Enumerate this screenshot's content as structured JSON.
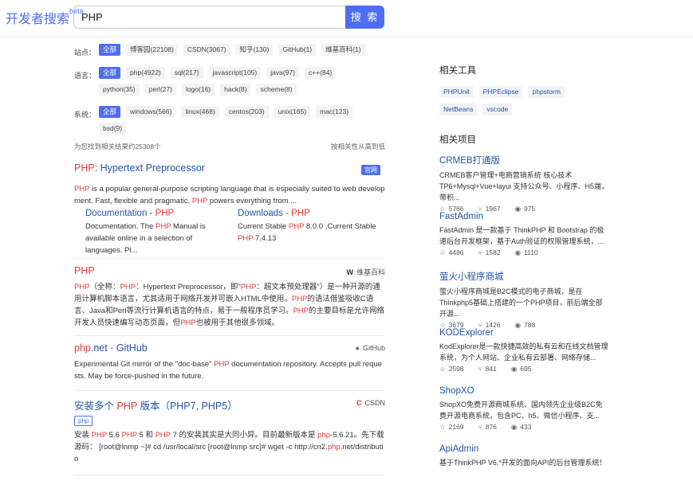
{
  "header": {
    "logo_text": "开发者搜索",
    "logo_beta": "beta",
    "query": "PHP",
    "search_button": "搜 索"
  },
  "filters": {
    "site": {
      "label": "站点：",
      "chips": [
        "全部",
        "博客园(22108)",
        "CSDN(3067)",
        "知乎(130)",
        "GitHub(1)",
        "维基百科(1)"
      ]
    },
    "language": {
      "label": "语言：",
      "chips": [
        "全部",
        "php(4922)",
        "sql(217)",
        "javascript(105)",
        "java(97)",
        "c++(84)",
        "python(35)",
        "perl(27)",
        "logo(16)",
        "hack(8)",
        "scheme(8)"
      ]
    },
    "system": {
      "label": "系统：",
      "chips": [
        "全部",
        "windows(566)",
        "linux(468)",
        "centos(203)",
        "unix(165)",
        "mac(123)",
        "bsd(9)"
      ]
    }
  },
  "meta": {
    "count_text": "为您找到相关结果约25308个",
    "sort_text": "按相关性从高到低"
  },
  "results": [
    {
      "title_hl": "PHP",
      "title_rest": ": Hypertext Preprocessor",
      "badge": "官网",
      "snippet_hl1": "PHP",
      "snippet_a": " is a popular general-purpose scripting language that is especially suited to web development. Fast, flexible and pragmatic, ",
      "snippet_hl2": "PHP",
      "snippet_b": " powers everything from ...",
      "sub_left": {
        "title_a": "Documentation - ",
        "title_hl": "PHP",
        "desc_a": "Documentation. The ",
        "desc_hl": "PHP",
        "desc_b": " Manual is available online in a selection of languages. Pl..."
      },
      "sub_right": {
        "title_a": "Downloads - ",
        "title_hl": "PHP",
        "desc_a": "Current Stable ",
        "desc_hl": "PHP",
        "desc_b": " 8.0.0 ,Current Stable ",
        "desc_hl2": "PHP",
        "desc_c": " 7.4.13"
      }
    },
    {
      "title_hl": "PHP",
      "source": "维基百科",
      "source_icon": "wikipedia-w",
      "t1": "PHP",
      "t2": "（全称：",
      "t3": "PHP",
      "t4": "：Hypertext Preprocessor，即\"",
      "t5": "PHP",
      "t6": "：超文本预处理器\"）是一种开源的通用计算机脚本语言，尤其适用于网络开发并可嵌入HTML中使用。",
      "t7": "PHP",
      "t8": "的语法借鉴吸收C语言、Java和Perl等流行计算机语言的特点，易于一般程序员学习。",
      "t9": "PHP",
      "t10": "的主要目标是允许网络开发人员快速编写动态页面，但",
      "t11": "PHP",
      "t12": "也被用于其他很多领域。"
    },
    {
      "title_a": "php",
      "title_b": ".net · GitHub",
      "source": "GitHub",
      "s_a": "Experimental Git mirror of the \"doc-base\" ",
      "s_hl": "PHP",
      "s_b": " documentation repository. Accepts pull requests. May be force-pushed in the future."
    },
    {
      "title_a": "安装多个 ",
      "title_hl": "PHP",
      "title_b": " 版本（PHP7, PHP5）",
      "source": "CSDN",
      "tag": "php",
      "s1": "安装 ",
      "s2": "PHP",
      "s3": " 5.6 ",
      "s4": "PHP",
      "s5": " 5 和 ",
      "s6": "PHP",
      "s7": " 7 的安装其实是大同小异。目前最新版本是 ",
      "s8": "php",
      "s9": "-5.6.21。先下载源码： [root@lnmp ~]# cd /usr/local/src [root@lnmp src]# wget -c http://cn2.",
      "s10": "php",
      "s11": ".net/distributio"
    }
  ],
  "sidebar": {
    "tools_title": "相关工具",
    "tools": [
      "PHPUnit",
      "PHPEclipse",
      "phpstorm",
      "NetBeans",
      "vscode"
    ],
    "projects_title": "相关项目",
    "projects": [
      {
        "name": "CRMEB打通版",
        "desc": "CRMEB客户管理+电商营销系统 核心技术TP6+Mysql+Vue+layui 支持公众号、小程序、H5端，带积...",
        "stars": "5766",
        "forks": "1967",
        "watch": "975"
      },
      {
        "name": "FastAdmin",
        "desc": "FastAdmin 是一款基于 ThinkPHP 和 Bootstrap 的极速后台开发框架，基于Auth验证的权限管理系统，...",
        "stars": "4486",
        "forks": "1582",
        "watch": "1110"
      },
      {
        "name": "萤火小程序商城",
        "desc": "萤火小程序商城是B2C模式的电子商城，是在Thinkphp5基础上搭建的一个PHP项目，前后端全部开源...",
        "stars": "3679",
        "forks": "1426",
        "watch": "788"
      },
      {
        "name": "KODExplorer",
        "desc": "KodExplorer是一款快捷高效的私有云和在线文档管理系统，为个人网站、企业私有云部署、网络存储...",
        "stars": "2598",
        "forks": "841",
        "watch": "695"
      },
      {
        "name": "ShopXO",
        "desc": "ShopXO免费开源商城系统、国内领先企业级B2C免费开源电商系统，包含PC、h5、微信小程序、支...",
        "stars": "2169",
        "forks": "876",
        "watch": "433"
      },
      {
        "name": "ApiAdmin",
        "desc": "基于ThinkPHP V6.*开发的面向API的后台管理系统！"
      }
    ]
  }
}
